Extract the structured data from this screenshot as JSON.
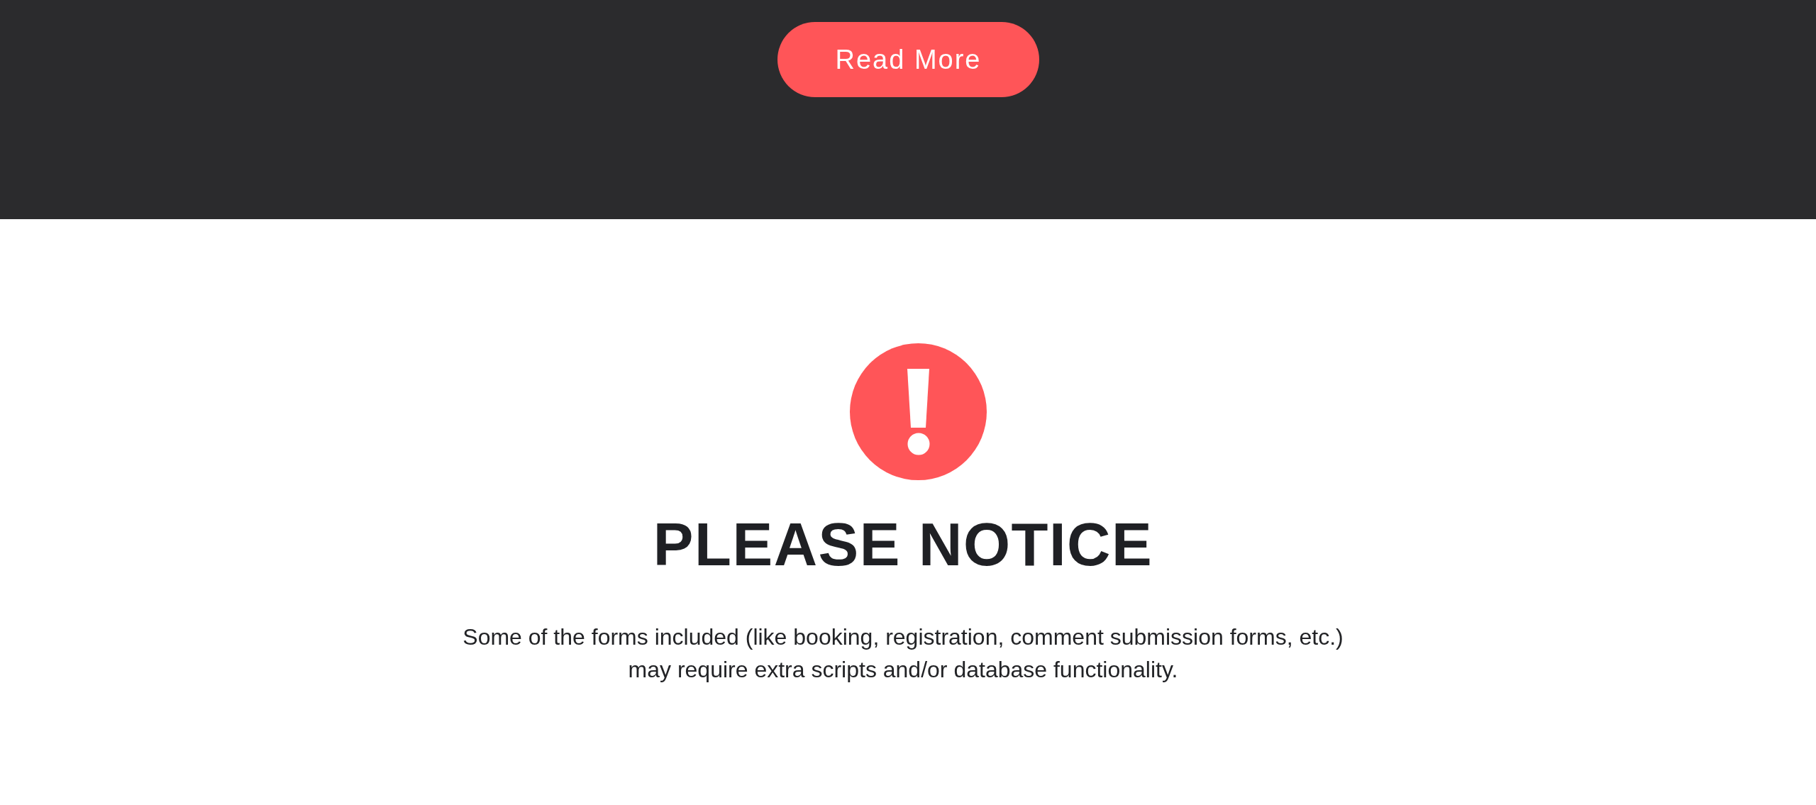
{
  "top_section": {
    "read_more_button": {
      "label": "Read More"
    }
  },
  "notice": {
    "title": "PLEASE NOTICE",
    "text": "Some of the forms included (like booking, registration, comment submission forms, etc.) may require extra scripts and/or database functionality."
  }
}
